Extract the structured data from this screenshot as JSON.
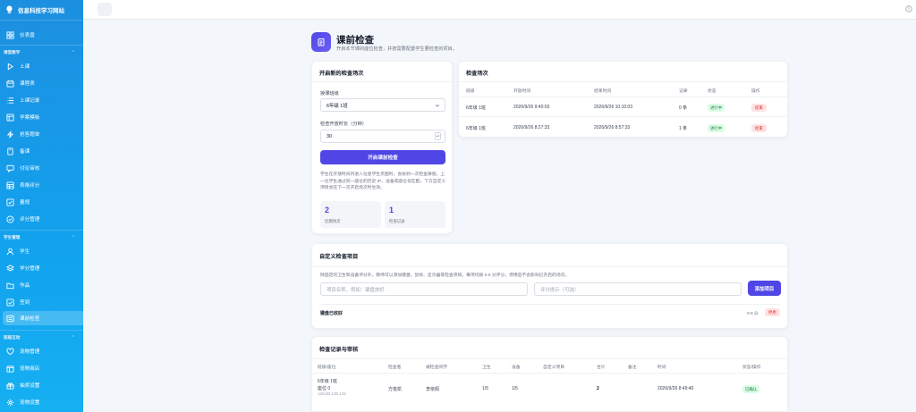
{
  "app": {
    "name": "信息科技学习网站"
  },
  "sidebar": {
    "top_item": {
      "label": "仪表盘",
      "icon": "dashboard-icon"
    },
    "groups": [
      {
        "title": "课堂教学",
        "items": [
          {
            "label": "上课",
            "icon": "play-icon"
          },
          {
            "label": "课程表",
            "icon": "calendar-icon"
          },
          {
            "label": "上课记录",
            "icon": "list-icon"
          },
          {
            "label": "学案模板",
            "icon": "template-icon"
          },
          {
            "label": "抢答题单",
            "icon": "lightning-icon"
          },
          {
            "label": "备课",
            "icon": "book-icon"
          },
          {
            "label": "讨论审核",
            "icon": "chat-icon"
          },
          {
            "label": "表格评分",
            "icon": "table-icon"
          },
          {
            "label": "量规",
            "icon": "check-icon"
          },
          {
            "label": "评分管理",
            "icon": "check-circle-icon"
          }
        ]
      },
      {
        "title": "学生管理",
        "items": [
          {
            "label": "学生",
            "icon": "user-icon"
          },
          {
            "label": "学分管理",
            "icon": "layers-icon"
          },
          {
            "label": "作品",
            "icon": "folder-icon"
          },
          {
            "label": "签到",
            "icon": "checkbox-icon"
          },
          {
            "label": "课前检查",
            "icon": "inspect-icon"
          }
        ]
      },
      {
        "title": "班级互动",
        "items": [
          {
            "label": "宠物管理",
            "icon": "heart-icon"
          },
          {
            "label": "宠物商店",
            "icon": "store-icon"
          },
          {
            "label": "抽奖设置",
            "icon": "gift-icon"
          },
          {
            "label": "宠物设置",
            "icon": "gear-icon"
          }
        ]
      }
    ],
    "active_label": "课前检查"
  },
  "page": {
    "title": "课前检查",
    "subtitle": "开启本节课的座位检查，并按需要配置学生要检查的项目。"
  },
  "start_card": {
    "title": "开启新的检查场次",
    "class_label": "授课班级",
    "class_value": "6年级 1班",
    "duration_label": "检查开放时长（分钟）",
    "duration_value": "30",
    "button_label": "开启课前检查",
    "note": "学生在开放时间内进入任意学生页面时，会收到一次检查弹窗。上一位学生通过同一座位的历史 IP、设备或座位号匹配。下方自定义项目会在下一次开启场次时生效。",
    "stats": [
      {
        "value": "2",
        "label": "近期场次"
      },
      {
        "value": "1",
        "label": "检查记录"
      }
    ]
  },
  "sessions_card": {
    "title": "检查场次",
    "columns": [
      "班级",
      "开放时间",
      "结束时间",
      "记录",
      "状态",
      "操作"
    ],
    "rows": [
      {
        "class": "6年级 1班",
        "start": "2026/9/26 9:40:03",
        "end": "2026/9/26 10:10:03",
        "records": "0 条",
        "status": "进行中",
        "action": "结束"
      },
      {
        "class": "6年级 1班",
        "start": "2026/9/26 8:27:33",
        "end": "2026/9/26 8:57:33",
        "records": "1 条",
        "status": "进行中",
        "action": "结束"
      }
    ]
  },
  "custom_card": {
    "title": "自定义检查项目",
    "description": "除固定的卫生和设备评分外，教师可以添加键盘、鼠标、显示器等检查项目。每项均按 0-5 分评分，停用后不会影响已开启的场次。",
    "name_placeholder": "项目名称，例如：键盘放好",
    "hint_placeholder": "评分提示（可选）",
    "add_button": "添加项目",
    "items": [
      {
        "name": "键盘已收好",
        "score": "0-5 分",
        "action": "停用"
      }
    ]
  },
  "records_card": {
    "title": "检查记录与审核",
    "columns": [
      "班级/座位",
      "检查者",
      "被检查同学",
      "卫生",
      "设备",
      "自定义项目",
      "合计",
      "备注",
      "时间",
      "状态/操作"
    ],
    "rows": [
      {
        "class": "6年级 1班",
        "seat": "座位 0",
        "ip": "125.80.138.122",
        "checker": "方俊凯",
        "checked": "李依佩",
        "hygiene": "1/5",
        "device": "1/5",
        "custom": "",
        "total": "2",
        "remark": "",
        "time": "2026/9/26 8:49:40",
        "status": "已确认"
      }
    ]
  },
  "colors": {
    "sidebar_top": "#1d8fe0",
    "sidebar_bottom": "#16b0f2",
    "primary": "#4f46e5",
    "success_bg": "#dcfce7",
    "success_text": "#15803d",
    "danger_bg": "#fee2e2",
    "danger_text": "#dc2626"
  }
}
